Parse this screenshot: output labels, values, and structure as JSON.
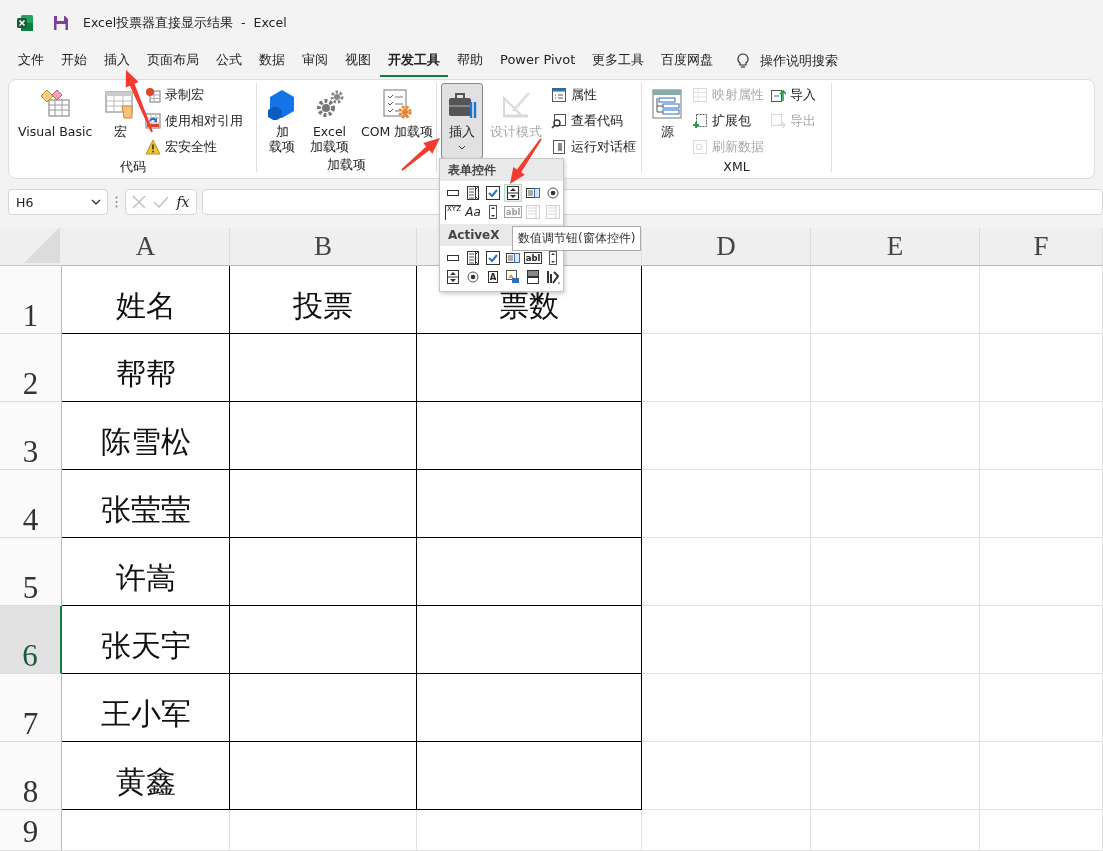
{
  "title_bar": {
    "document": "Excel投票器直接显示结果",
    "separator": "-",
    "app": "Excel"
  },
  "tabs": [
    {
      "label": "文件",
      "selected": false
    },
    {
      "label": "开始",
      "selected": false
    },
    {
      "label": "插入",
      "selected": false
    },
    {
      "label": "页面布局",
      "selected": false
    },
    {
      "label": "公式",
      "selected": false
    },
    {
      "label": "数据",
      "selected": false
    },
    {
      "label": "审阅",
      "selected": false
    },
    {
      "label": "视图",
      "selected": false
    },
    {
      "label": "开发工具",
      "selected": true
    },
    {
      "label": "帮助",
      "selected": false
    },
    {
      "label": "Power Pivot",
      "selected": false
    },
    {
      "label": "更多工具",
      "selected": false
    },
    {
      "label": "百度网盘",
      "selected": false
    }
  ],
  "search": {
    "label": "操作说明搜索"
  },
  "ribbon": {
    "groups": [
      {
        "label": "代码",
        "items": [
          {
            "lines": [
              "Visual Basic"
            ],
            "disabled": false,
            "pressed": false
          },
          {
            "lines": [
              "宏"
            ],
            "disabled": false,
            "pressed": false
          },
          {
            "lines": [
              "录制宏"
            ],
            "disabled": false,
            "pressed": false
          },
          {
            "lines": [
              "使用相对引用"
            ],
            "disabled": false,
            "pressed": false
          },
          {
            "lines": [
              "宏安全性"
            ],
            "disabled": false,
            "pressed": false
          }
        ]
      },
      {
        "label": "加载项",
        "items": [
          {
            "lines": [
              "加",
              "载项"
            ],
            "disabled": false,
            "pressed": false
          },
          {
            "lines": [
              "Excel",
              "加载项"
            ],
            "disabled": false,
            "pressed": false
          },
          {
            "lines": [
              "COM 加载项"
            ],
            "disabled": false,
            "pressed": false
          }
        ]
      },
      {
        "items": [
          {
            "lines": [
              "插入"
            ],
            "disabled": false,
            "pressed": true
          },
          {
            "lines": [
              "设计模式"
            ],
            "disabled": true,
            "pressed": false
          },
          {
            "lines": [
              "属性"
            ],
            "disabled": false,
            "pressed": false
          },
          {
            "lines": [
              "查看代码"
            ],
            "disabled": false,
            "pressed": false
          },
          {
            "lines": [
              "运行对话框"
            ],
            "disabled": false,
            "pressed": false
          }
        ]
      },
      {
        "label": "XML",
        "items": [
          {
            "lines": [
              "源"
            ],
            "disabled": false,
            "pressed": false
          },
          {
            "lines": [
              "映射属性"
            ],
            "disabled": true,
            "pressed": false
          },
          {
            "lines": [
              "扩展包"
            ],
            "disabled": false,
            "pressed": false
          },
          {
            "lines": [
              "刷新数据"
            ],
            "disabled": true,
            "pressed": false
          },
          {
            "lines": [
              "导入"
            ],
            "disabled": false,
            "pressed": false
          },
          {
            "lines": [
              "导出"
            ],
            "disabled": true,
            "pressed": false
          }
        ]
      }
    ]
  },
  "formula_bar": {
    "name_box": "H6",
    "function_label": "fx"
  },
  "insert_menu": {
    "sections": [
      {
        "title": "表单控件",
        "items": [
          {
            "disabled": false,
            "highlighted": false
          },
          {
            "disabled": false,
            "highlighted": false
          },
          {
            "disabled": false,
            "highlighted": false
          },
          {
            "disabled": false,
            "highlighted": true
          },
          {
            "disabled": false,
            "highlighted": false
          },
          {
            "disabled": false,
            "highlighted": false
          },
          {
            "text": "XYZ",
            "disabled": false,
            "highlighted": false
          },
          {
            "text": "Aa",
            "disabled": false,
            "highlighted": false
          },
          {
            "disabled": false,
            "highlighted": false
          },
          {
            "text": "abl",
            "disabled": true,
            "highlighted": false
          },
          {
            "disabled": true,
            "highlighted": false
          },
          {
            "disabled": true,
            "highlighted": false
          }
        ]
      },
      {
        "title": "ActiveX",
        "items": [
          {
            "disabled": false,
            "highlighted": false
          },
          {
            "disabled": false,
            "highlighted": false
          },
          {
            "disabled": false,
            "highlighted": false
          },
          {
            "disabled": false,
            "highlighted": false
          },
          {
            "text": "abl",
            "disabled": false,
            "highlighted": false
          },
          {
            "disabled": false,
            "highlighted": false
          },
          {
            "disabled": false,
            "highlighted": false
          },
          {
            "disabled": false,
            "highlighted": false
          },
          {
            "text": "A",
            "disabled": false,
            "highlighted": false
          },
          {
            "disabled": false,
            "highlighted": false
          },
          {
            "disabled": false,
            "highlighted": false
          },
          {
            "disabled": false,
            "highlighted": false
          }
        ]
      }
    ]
  },
  "tooltip": {
    "text": "数值调节钮(窗体控件)"
  },
  "sheet": {
    "column_headers": [
      "A",
      "B",
      "D",
      "E",
      "F"
    ],
    "rows": [
      {
        "number": "1",
        "selected": false,
        "cells": [
          "姓名",
          "投票",
          "票数"
        ]
      },
      {
        "number": "2",
        "selected": false,
        "cells": [
          "帮帮"
        ]
      },
      {
        "number": "3",
        "selected": false,
        "cells": [
          "陈雪松"
        ]
      },
      {
        "number": "4",
        "selected": false,
        "cells": [
          "张莹莹"
        ]
      },
      {
        "number": "5",
        "selected": false,
        "cells": [
          "许嵩"
        ]
      },
      {
        "number": "6",
        "selected": true,
        "cells": [
          "张天宇"
        ]
      },
      {
        "number": "7",
        "selected": false,
        "cells": [
          "王小军"
        ]
      },
      {
        "number": "8",
        "selected": false,
        "cells": [
          "黄鑫"
        ]
      },
      {
        "number": "9",
        "selected": false
      }
    ]
  }
}
